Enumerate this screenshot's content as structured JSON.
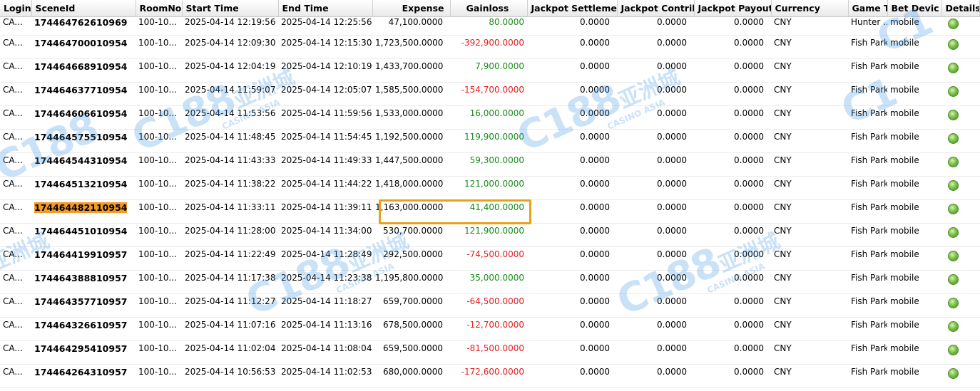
{
  "columns": [
    "Login",
    "SceneId",
    "RoomNo...",
    "Start Time",
    "End Time",
    "Expense",
    "Gainloss",
    "Jackpot Settlement",
    "Jackpot Contribu",
    "Jackpot Payout",
    "Currency",
    "Game Typ",
    "Bet Devic",
    "Details"
  ],
  "rows": [
    {
      "login": "CA...",
      "scene_id": "174464762610969",
      "room": "100-10...",
      "start": "2025-04-14 12:19:56",
      "end": "2025-04-14 12:25:56",
      "expense": "47,100.0000",
      "gainloss": "80.0000",
      "gain_sign": "pos",
      "jp_settle": "0.0000",
      "jp_contrib": "0.0000",
      "jp_payout": "0.0000",
      "currency": "CNY",
      "game_type": "Hunter ...",
      "device": "mobile"
    },
    {
      "login": "CA...",
      "scene_id": "174464700010954",
      "room": "100-10...",
      "start": "2025-04-14 12:09:30",
      "end": "2025-04-14 12:15:30",
      "expense": "1,723,500.0000",
      "gainloss": "-392,900.0000",
      "gain_sign": "neg",
      "jp_settle": "0.0000",
      "jp_contrib": "0.0000",
      "jp_payout": "0.0000",
      "currency": "CNY",
      "game_type": "Fish Park",
      "device": "mobile"
    },
    {
      "login": "CA...",
      "scene_id": "174464668910954",
      "room": "100-10...",
      "start": "2025-04-14 12:04:19",
      "end": "2025-04-14 12:10:19",
      "expense": "1,433,700.0000",
      "gainloss": "7,900.0000",
      "gain_sign": "pos",
      "jp_settle": "0.0000",
      "jp_contrib": "0.0000",
      "jp_payout": "0.0000",
      "currency": "CNY",
      "game_type": "Fish Park",
      "device": "mobile"
    },
    {
      "login": "CA...",
      "scene_id": "174464637710954",
      "room": "100-10...",
      "start": "2025-04-14 11:59:07",
      "end": "2025-04-14 12:05:07",
      "expense": "1,585,500.0000",
      "gainloss": "-154,700.0000",
      "gain_sign": "neg",
      "jp_settle": "0.0000",
      "jp_contrib": "0.0000",
      "jp_payout": "0.0000",
      "currency": "CNY",
      "game_type": "Fish Park",
      "device": "mobile"
    },
    {
      "login": "CA...",
      "scene_id": "174464606610954",
      "room": "100-10...",
      "start": "2025-04-14 11:53:56",
      "end": "2025-04-14 11:59:56",
      "expense": "1,533,000.0000",
      "gainloss": "16,000.0000",
      "gain_sign": "pos",
      "jp_settle": "0.0000",
      "jp_contrib": "0.0000",
      "jp_payout": "0.0000",
      "currency": "CNY",
      "game_type": "Fish Park",
      "device": "mobile"
    },
    {
      "login": "CA...",
      "scene_id": "174464575510954",
      "room": "100-10...",
      "start": "2025-04-14 11:48:45",
      "end": "2025-04-14 11:54:45",
      "expense": "1,192,500.0000",
      "gainloss": "119,900.0000",
      "gain_sign": "pos",
      "jp_settle": "0.0000",
      "jp_contrib": "0.0000",
      "jp_payout": "0.0000",
      "currency": "CNY",
      "game_type": "Fish Park",
      "device": "mobile"
    },
    {
      "login": "CA...",
      "scene_id": "174464544310954",
      "room": "100-10...",
      "start": "2025-04-14 11:43:33",
      "end": "2025-04-14 11:49:33",
      "expense": "1,447,500.0000",
      "gainloss": "59,300.0000",
      "gain_sign": "pos",
      "jp_settle": "0.0000",
      "jp_contrib": "0.0000",
      "jp_payout": "0.0000",
      "currency": "CNY",
      "game_type": "Fish Park",
      "device": "mobile"
    },
    {
      "login": "CA...",
      "scene_id": "174464513210954",
      "room": "100-10...",
      "start": "2025-04-14 11:38:22",
      "end": "2025-04-14 11:44:22",
      "expense": "1,418,000.0000",
      "gainloss": "121,000.0000",
      "gain_sign": "pos",
      "jp_settle": "0.0000",
      "jp_contrib": "0.0000",
      "jp_payout": "0.0000",
      "currency": "CNY",
      "game_type": "Fish Park",
      "device": "mobile"
    },
    {
      "login": "CA...",
      "scene_id": "174464482110954",
      "room": "100-10...",
      "start": "2025-04-14 11:33:11",
      "end": "2025-04-14 11:39:11",
      "expense": "1,163,000.0000",
      "gainloss": "41,400.0000",
      "gain_sign": "pos",
      "jp_settle": "0.0000",
      "jp_contrib": "0.0000",
      "jp_payout": "0.0000",
      "currency": "CNY",
      "game_type": "Fish Park",
      "device": "mobile",
      "highlighted": true
    },
    {
      "login": "CA...",
      "scene_id": "174464451010954",
      "room": "100-10...",
      "start": "2025-04-14 11:28:00",
      "end": "2025-04-14 11:34:00",
      "expense": "530,700.0000",
      "gainloss": "121,900.0000",
      "gain_sign": "pos",
      "jp_settle": "0.0000",
      "jp_contrib": "0.0000",
      "jp_payout": "0.0000",
      "currency": "CNY",
      "game_type": "Fish Park",
      "device": "mobile"
    },
    {
      "login": "CA...",
      "scene_id": "174464419910957",
      "room": "100-10...",
      "start": "2025-04-14 11:22:49",
      "end": "2025-04-14 11:28:49",
      "expense": "292,500.0000",
      "gainloss": "-74,500.0000",
      "gain_sign": "neg",
      "jp_settle": "0.0000",
      "jp_contrib": "0.0000",
      "jp_payout": "0.0000",
      "currency": "CNY",
      "game_type": "Fish Park",
      "device": "mobile"
    },
    {
      "login": "CA...",
      "scene_id": "174464388810957",
      "room": "100-10...",
      "start": "2025-04-14 11:17:38",
      "end": "2025-04-14 11:23:38",
      "expense": "1,195,800.0000",
      "gainloss": "35,000.0000",
      "gain_sign": "pos",
      "jp_settle": "0.0000",
      "jp_contrib": "0.0000",
      "jp_payout": "0.0000",
      "currency": "CNY",
      "game_type": "Fish Park",
      "device": "mobile"
    },
    {
      "login": "CA...",
      "scene_id": "174464357710957",
      "room": "100-10...",
      "start": "2025-04-14 11:12:27",
      "end": "2025-04-14 11:18:27",
      "expense": "659,700.0000",
      "gainloss": "-64,500.0000",
      "gain_sign": "neg",
      "jp_settle": "0.0000",
      "jp_contrib": "0.0000",
      "jp_payout": "0.0000",
      "currency": "CNY",
      "game_type": "Fish Park",
      "device": "mobile"
    },
    {
      "login": "CA...",
      "scene_id": "174464326610957",
      "room": "100-10...",
      "start": "2025-04-14 11:07:16",
      "end": "2025-04-14 11:13:16",
      "expense": "678,500.0000",
      "gainloss": "-12,700.0000",
      "gain_sign": "neg",
      "jp_settle": "0.0000",
      "jp_contrib": "0.0000",
      "jp_payout": "0.0000",
      "currency": "CNY",
      "game_type": "Fish Park",
      "device": "mobile"
    },
    {
      "login": "CA...",
      "scene_id": "174464295410957",
      "room": "100-10...",
      "start": "2025-04-14 11:02:04",
      "end": "2025-04-14 11:08:04",
      "expense": "659,500.0000",
      "gainloss": "-81,500.0000",
      "gain_sign": "neg",
      "jp_settle": "0.0000",
      "jp_contrib": "0.0000",
      "jp_payout": "0.0000",
      "currency": "CNY",
      "game_type": "Fish Park",
      "device": "mobile"
    },
    {
      "login": "CA...",
      "scene_id": "174464264310957",
      "room": "100-10...",
      "start": "2025-04-14 10:56:53",
      "end": "2025-04-14 11:02:53",
      "expense": "680,000.0000",
      "gainloss": "-172,600.0000",
      "gain_sign": "neg",
      "jp_settle": "0.0000",
      "jp_contrib": "0.0000",
      "jp_payout": "0.0000",
      "currency": "CNY",
      "game_type": "Fish Park",
      "device": "mobile"
    }
  ],
  "details_icon": "green-circle-icon",
  "colors": {
    "positive": "#1a8a1a",
    "negative": "#e02020",
    "highlight": "#f29b2b",
    "box": "#e8a21a"
  },
  "watermark": {
    "brand": "C188",
    "cn": "亚洲城",
    "sub": "CASINO ASIA"
  }
}
